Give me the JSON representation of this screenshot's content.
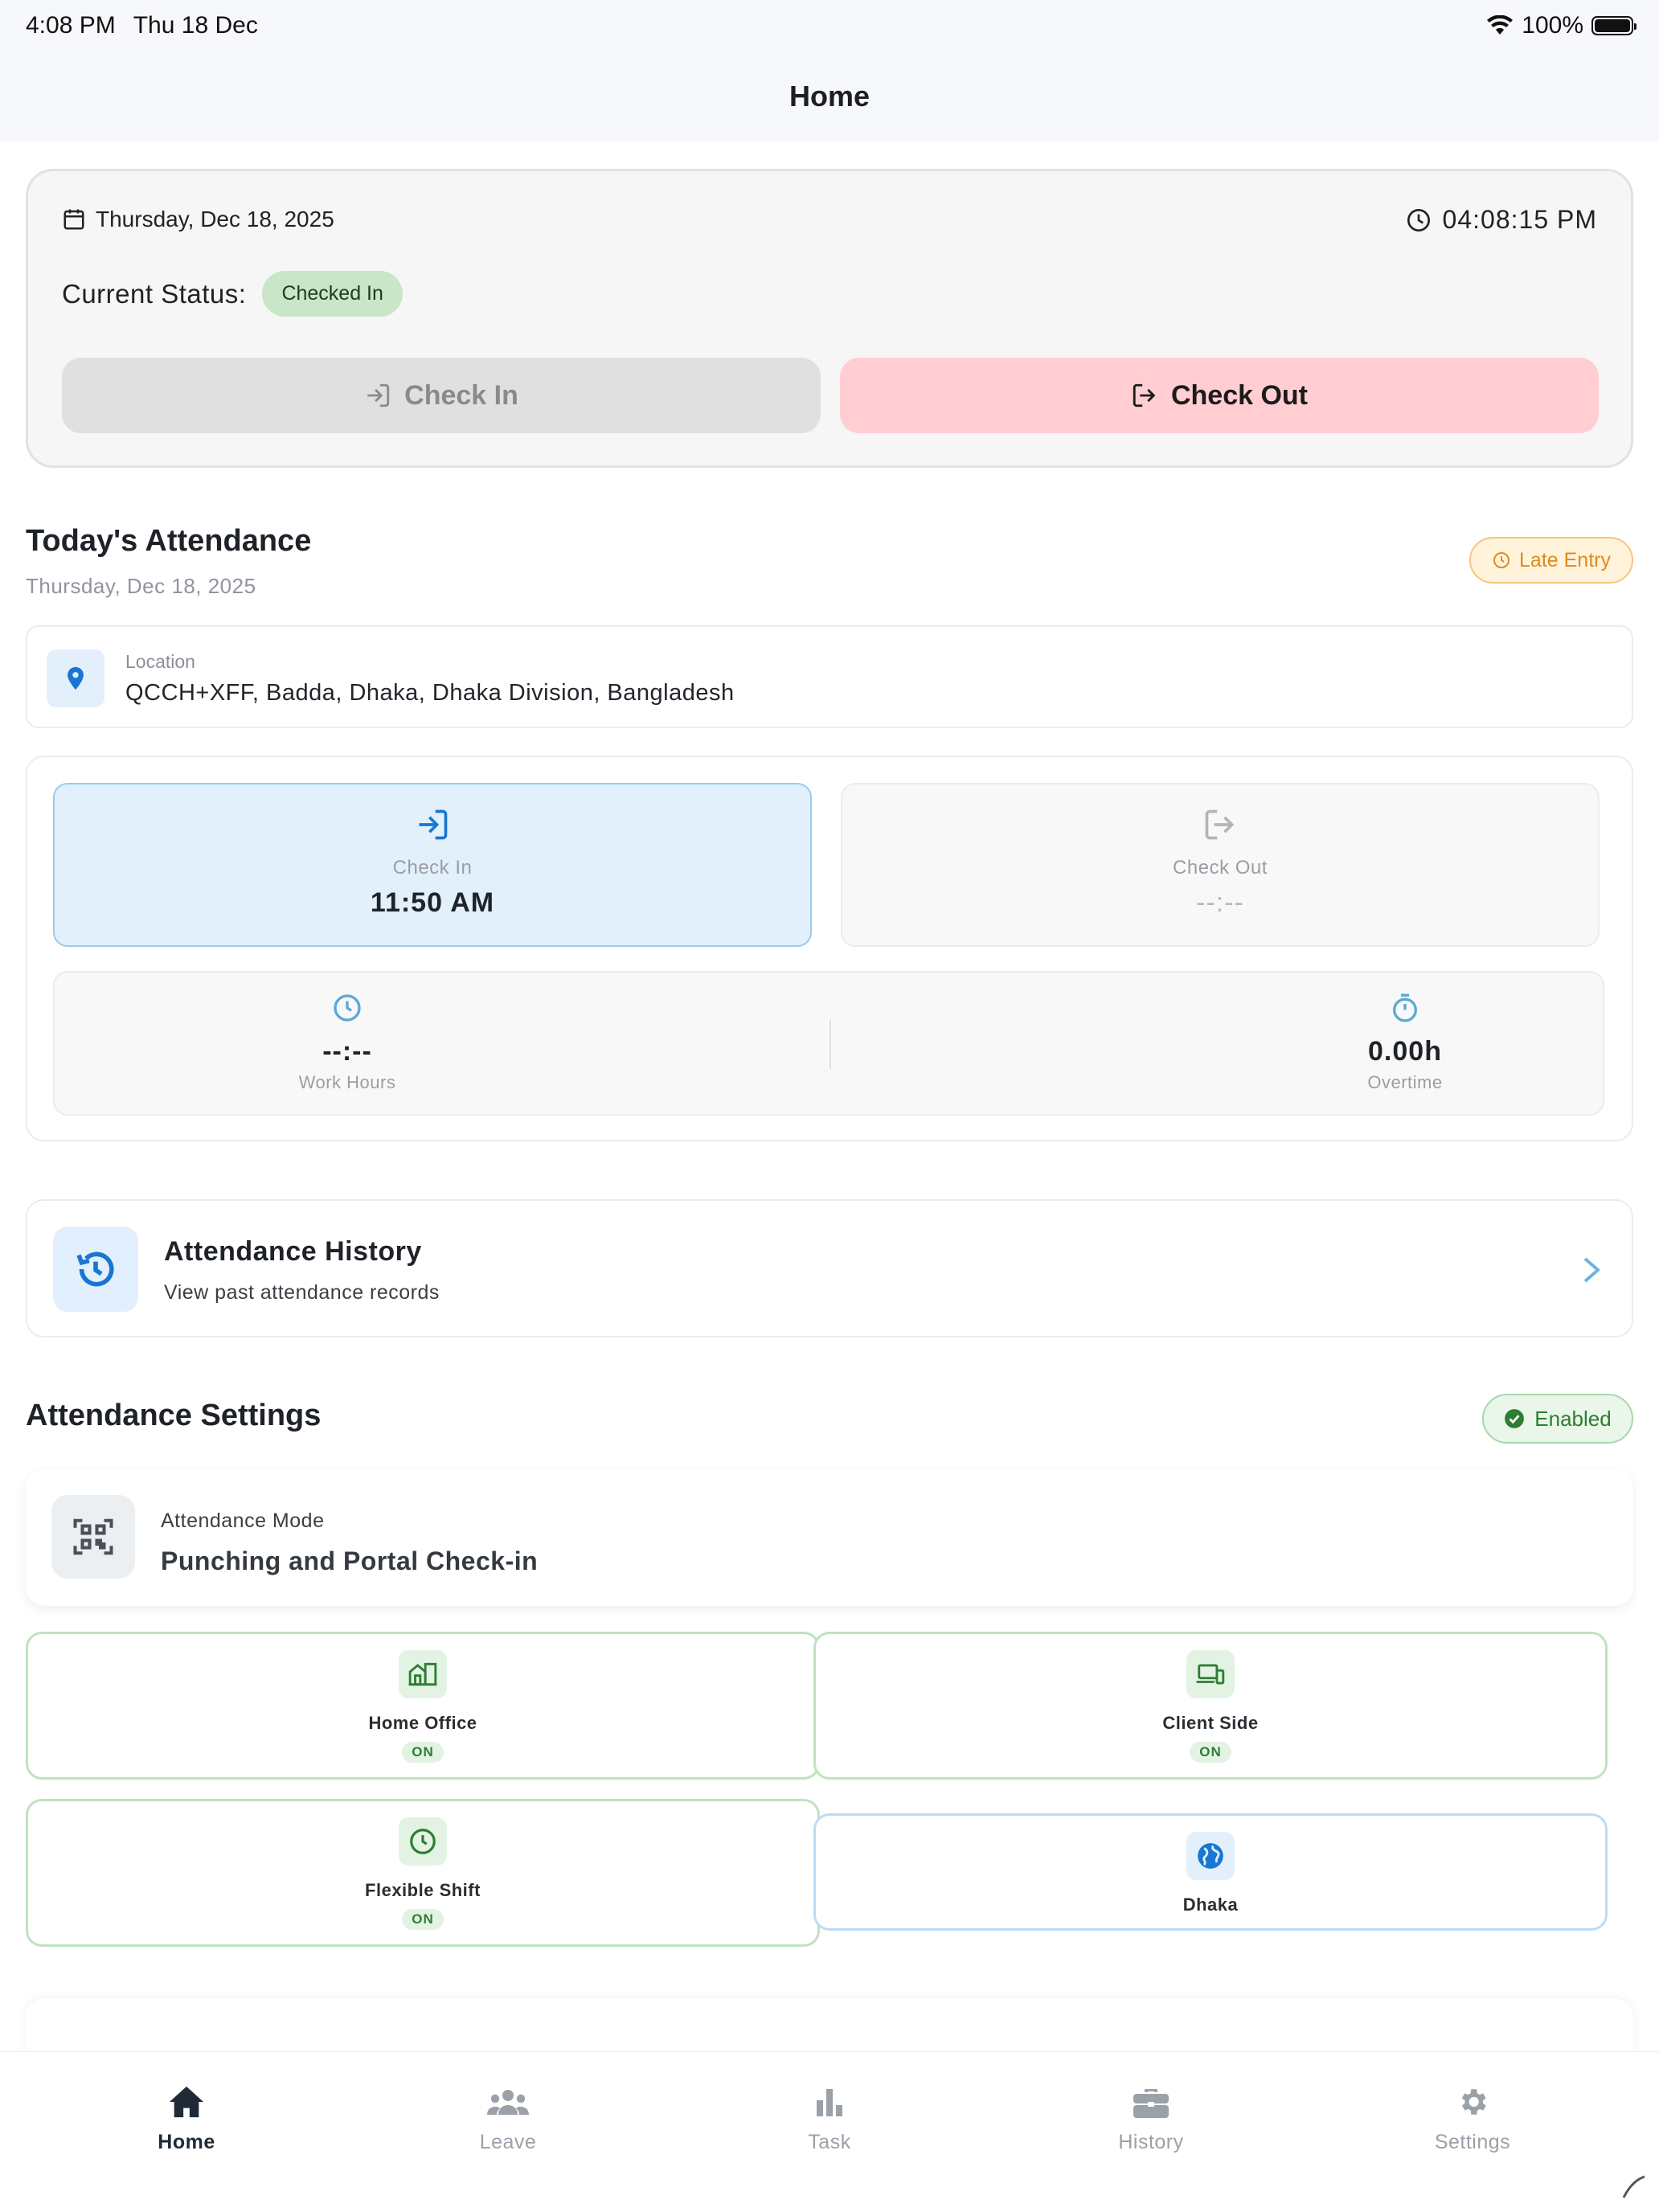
{
  "status_bar": {
    "time": "4:08 PM",
    "date": "Thu 18 Dec",
    "battery": "100%"
  },
  "nav": {
    "title": "Home"
  },
  "status_card": {
    "date": "Thursday, Dec 18, 2025",
    "clock": "04:08:15 PM",
    "status_label": "Current Status:",
    "status_value": "Checked In",
    "check_in_label": "Check In",
    "check_out_label": "Check Out"
  },
  "today": {
    "title": "Today's Attendance",
    "date": "Thursday, Dec 18, 2025",
    "badge": "Late Entry",
    "location_label": "Location",
    "location_value": "QCCH+XFF, Badda, Dhaka, Dhaka Division, Bangladesh",
    "check_in": {
      "label": "Check In",
      "value": "11:50 AM"
    },
    "check_out": {
      "label": "Check Out",
      "value": "--:--"
    },
    "work_hours": {
      "label": "Work Hours",
      "value": "--:--"
    },
    "overtime": {
      "label": "Overtime",
      "value": "0.00h"
    }
  },
  "history": {
    "title": "Attendance History",
    "subtitle": "View past attendance records"
  },
  "settings": {
    "title": "Attendance Settings",
    "badge": "Enabled",
    "mode_label": "Attendance Mode",
    "mode_value": "Punching and Portal Check-in",
    "options": [
      {
        "label": "Home Office",
        "state": "ON"
      },
      {
        "label": "Client Side",
        "state": "ON"
      },
      {
        "label": "Flexible Shift",
        "state": "ON"
      },
      {
        "label": "Dhaka"
      }
    ]
  },
  "tabs": [
    {
      "label": "Home",
      "icon": "home-icon",
      "active": true
    },
    {
      "label": "Leave",
      "icon": "people-icon"
    },
    {
      "label": "Task",
      "icon": "bar-chart-icon"
    },
    {
      "label": "History",
      "icon": "briefcase-icon"
    },
    {
      "label": "Settings",
      "icon": "gear-icon"
    }
  ],
  "colors": {
    "accent_blue": "#1976d2",
    "success_green": "#2e7d32",
    "warning_orange": "#e08a1e",
    "checkout_pink": "#ffcdd2"
  }
}
